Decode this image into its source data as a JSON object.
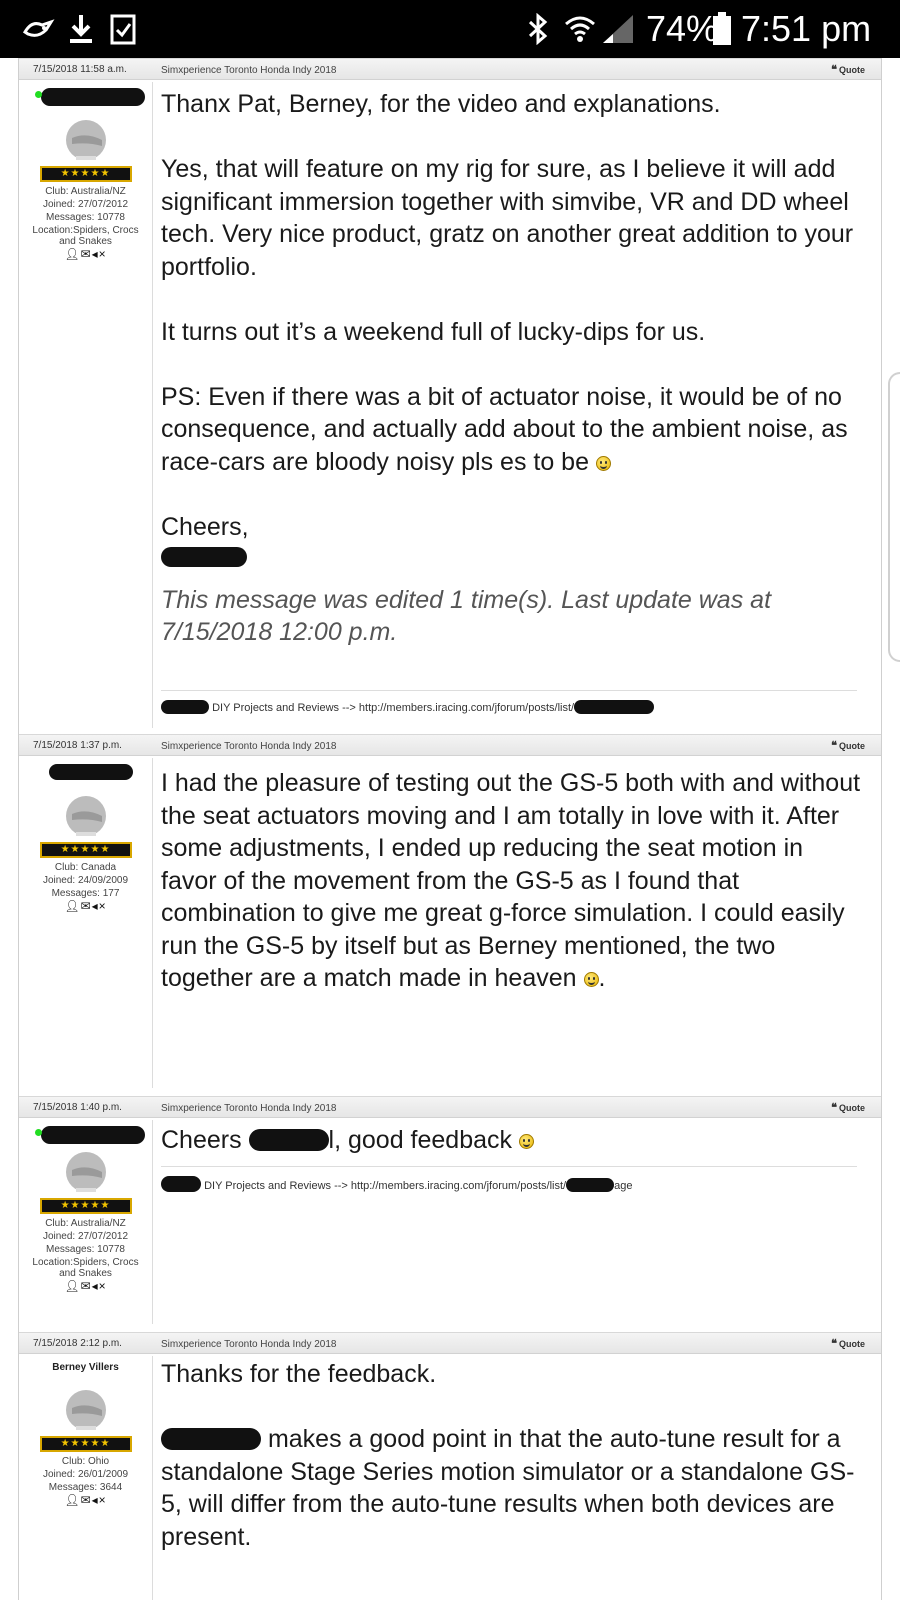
{
  "status_bar": {
    "battery": "74%",
    "time": "7:51 pm"
  },
  "forum": {
    "posts": [
      {
        "date": "7/15/2018 11:58 a.m.",
        "topic": "Simxperience Toronto Honda Indy 2018",
        "quote_label": "Quote",
        "user": {
          "club": "Club: Australia/NZ",
          "joined": "Joined: 27/07/2012",
          "messages": "Messages: 10778",
          "location": "Location:Spiders, Crocs and Snakes"
        },
        "body": {
          "p1": "Thanx Pat, Berney, for the video and explanations.",
          "p2": "Yes, that will feature on my rig for sure, as I believe it will add significant immersion together with simvibe, VR and DD wheel tech. Very nice product, gratz on another great addition to your portfolio.",
          "p3": "It turns out it’s a weekend full of lucky-dips for us.",
          "p4": "PS: Even if there was a bit of actuator noise, it would be of no consequence, and actually add about to the ambient noise, as race-cars are bloody noisy pls es to be",
          "p5": "Cheers,",
          "edit_note": "This message was edited 1 time(s). Last update was at 7/15/2018 12:00 p.m."
        },
        "signature": {
          "label": "DIY Projects and Reviews --> ",
          "link": "http://members.iracing.com/jforum/posts/list/"
        }
      },
      {
        "date": "7/15/2018 1:37 p.m.",
        "topic": "Simxperience Toronto Honda Indy 2018",
        "quote_label": "Quote",
        "user": {
          "club": "Club: Canada",
          "joined": "Joined: 24/09/2009",
          "messages": "Messages: 177"
        },
        "body": {
          "p1": "I had the pleasure of testing out the GS-5 both with and without the seat actuators moving and I am totally in love with it. After some adjustments, I ended up reducing the seat motion in favor of the movement from the GS-5 as I found that combination to give me great g-force simulation. I could easily run the GS-5 by itself but as Berney mentioned, the two together are a match made in heaven",
          "p1_end": "."
        }
      },
      {
        "date": "7/15/2018 1:40 p.m.",
        "topic": "Simxperience Toronto Honda Indy 2018",
        "quote_label": "Quote",
        "user": {
          "club": "Club: Australia/NZ",
          "joined": "Joined: 27/07/2012",
          "messages": "Messages: 10778",
          "location": "Location:Spiders, Crocs and Snakes"
        },
        "body": {
          "p1_start": "Cheers ",
          "p1_end": "l, good feedback"
        },
        "signature": {
          "label": "DIY Projects and Reviews --> ",
          "link": "http://members.iracing.com/jforum/posts/list/",
          "tail": "age"
        }
      },
      {
        "date": "7/15/2018 2:12 p.m.",
        "topic": "Simxperience Toronto Honda Indy 2018",
        "quote_label": "Quote",
        "user": {
          "name": "Berney Villers",
          "club": "Club: Ohio",
          "joined": "Joined: 26/01/2009",
          "messages": "Messages: 3644"
        },
        "body": {
          "p1": "Thanks for the feedback.",
          "p2_end": "makes a good point in that the auto-tune result for a standalone Stage Series motion simulator or a standalone GS-5, will differ from the auto-tune results when both devices are present."
        }
      }
    ]
  },
  "icons": {
    "status_left": [
      "assistant-icon",
      "download-icon",
      "checkbox-icon"
    ],
    "status_right": [
      "bluetooth-icon",
      "wifi-icon",
      "signal-icon",
      "battery-icon"
    ],
    "post": [
      "avatar-helmet-icon",
      "profile-icon",
      "mail-icon",
      "mute-icon",
      "quote-icon",
      "smiley-icon"
    ]
  },
  "colors": {
    "status_bar": "#000000",
    "online": "#22dd22",
    "rank_gold": "#f2c400"
  }
}
